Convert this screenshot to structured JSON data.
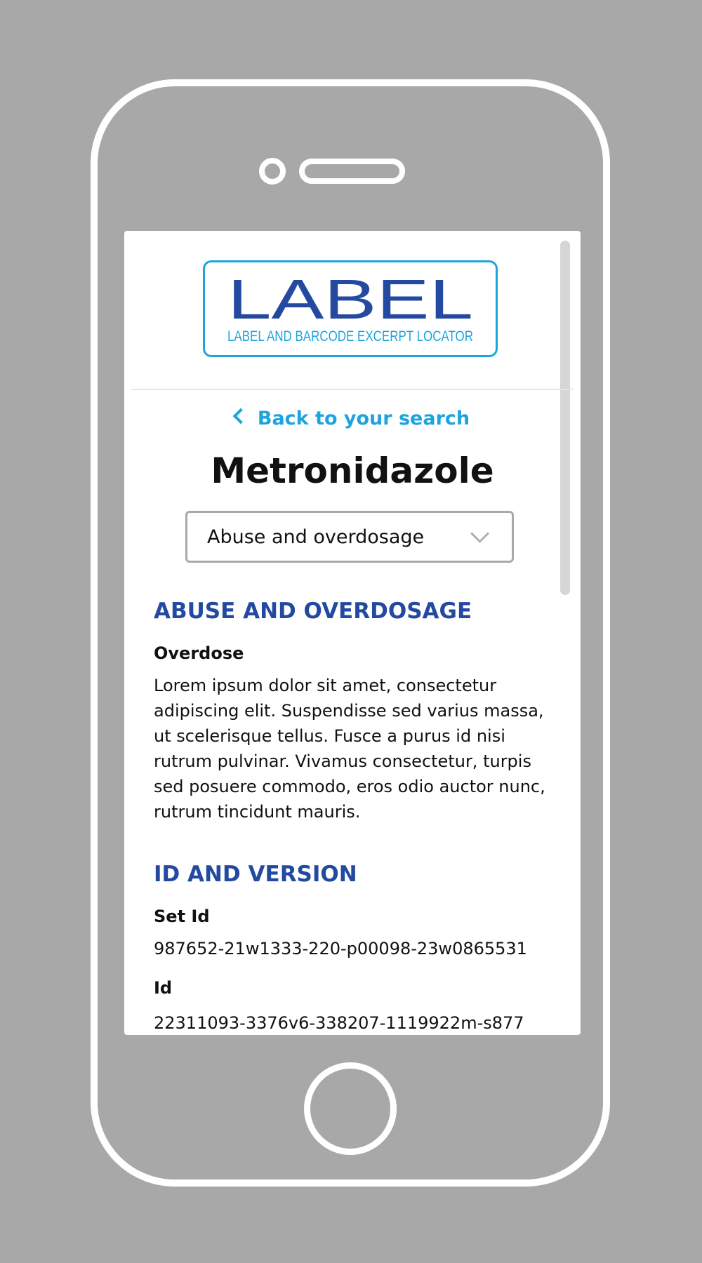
{
  "logo": {
    "wordmark": "LABEL",
    "tagline": "LABEL AND BARCODE EXCERPT LOCATOR"
  },
  "nav": {
    "back_label": "Back to your search"
  },
  "drug": {
    "name": "Metronidazole"
  },
  "section_select": {
    "selected": "Abuse and overdosage"
  },
  "sections": {
    "abuse": {
      "heading": "ABUSE AND OVERDOSAGE",
      "subheading": "Overdose",
      "body": "Lorem ipsum dolor sit amet, consectetur adipiscing elit. Suspendisse sed varius massa, ut scelerisque tellus. Fusce a purus id nisi rutrum pulvinar. Vivamus consectetur, turpis sed posuere commodo, eros odio auctor nunc, rutrum tincidunt mauris."
    },
    "id_version": {
      "heading": "ID AND VERSION",
      "set_id_label": "Set Id",
      "set_id_value": "987652-21w1333-220-p00098-23w0865531",
      "id_label": "Id",
      "id_value": "22311093-3376v6-338207-1119922m-s877"
    }
  },
  "colors": {
    "accent": "#1ea4dc",
    "heading": "#2349a1",
    "device_bg": "#a8a8a8"
  }
}
